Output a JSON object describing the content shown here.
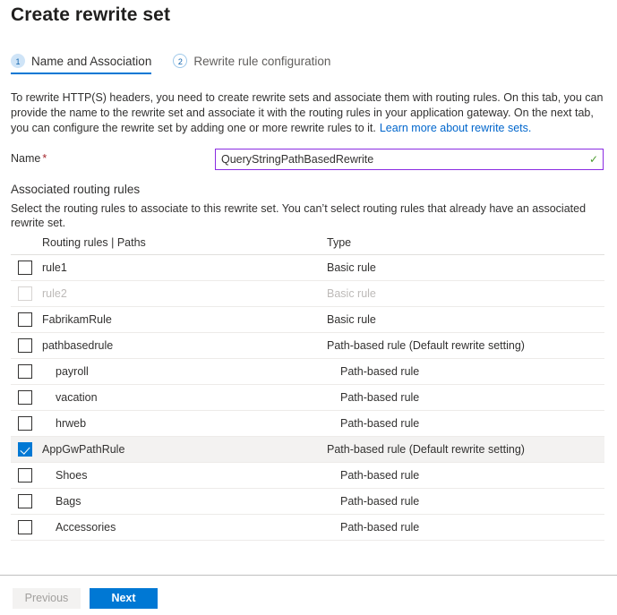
{
  "page": {
    "title": "Create rewrite set"
  },
  "wizard": {
    "steps": [
      {
        "number": "1",
        "label": "Name and Association",
        "state": "active"
      },
      {
        "number": "2",
        "label": "Rewrite rule configuration",
        "state": "inactive"
      }
    ]
  },
  "intro": {
    "text": "To rewrite HTTP(S) headers, you need to create rewrite sets and associate them with routing rules. On this tab, you can provide the name to the rewrite set and associate it with the routing rules in your application gateway. On the next tab, you can configure the rewrite set by adding one or more rewrite rules to it.",
    "link_label": "Learn more about rewrite sets."
  },
  "name_field": {
    "label": "Name",
    "required_marker": "*",
    "value": "QueryStringPathBasedRewrite",
    "placeholder": "",
    "valid_icon": "checkmark-icon",
    "border_color": "#8a2be2",
    "valid_color": "#4a9c2d"
  },
  "associated": {
    "heading": "Associated routing rules",
    "description": "Select the routing rules to associate to this rewrite set. You can’t select routing rules that already have an associated rewrite set."
  },
  "table": {
    "headers": {
      "name": "Routing rules | Paths",
      "type": "Type"
    },
    "rows": [
      {
        "name": "rule1",
        "type": "Basic rule",
        "checked": false,
        "disabled": false,
        "indent": false
      },
      {
        "name": "rule2",
        "type": "Basic rule",
        "checked": false,
        "disabled": true,
        "indent": false
      },
      {
        "name": "FabrikamRule",
        "type": "Basic rule",
        "checked": false,
        "disabled": false,
        "indent": false
      },
      {
        "name": "pathbasedrule",
        "type": "Path-based rule (Default rewrite setting)",
        "checked": false,
        "disabled": false,
        "indent": false
      },
      {
        "name": "payroll",
        "type": "Path-based rule",
        "checked": false,
        "disabled": false,
        "indent": true
      },
      {
        "name": "vacation",
        "type": "Path-based rule",
        "checked": false,
        "disabled": false,
        "indent": true
      },
      {
        "name": "hrweb",
        "type": "Path-based rule",
        "checked": false,
        "disabled": false,
        "indent": true
      },
      {
        "name": "AppGwPathRule",
        "type": "Path-based rule (Default rewrite setting)",
        "checked": true,
        "disabled": false,
        "indent": false
      },
      {
        "name": "Shoes",
        "type": "Path-based rule",
        "checked": false,
        "disabled": false,
        "indent": true
      },
      {
        "name": "Bags",
        "type": "Path-based rule",
        "checked": false,
        "disabled": false,
        "indent": true
      },
      {
        "name": "Accessories",
        "type": "Path-based rule",
        "checked": false,
        "disabled": false,
        "indent": true
      }
    ]
  },
  "footer": {
    "previous_label": "Previous",
    "previous_disabled": true,
    "next_label": "Next",
    "accent_color": "#0078d4"
  }
}
